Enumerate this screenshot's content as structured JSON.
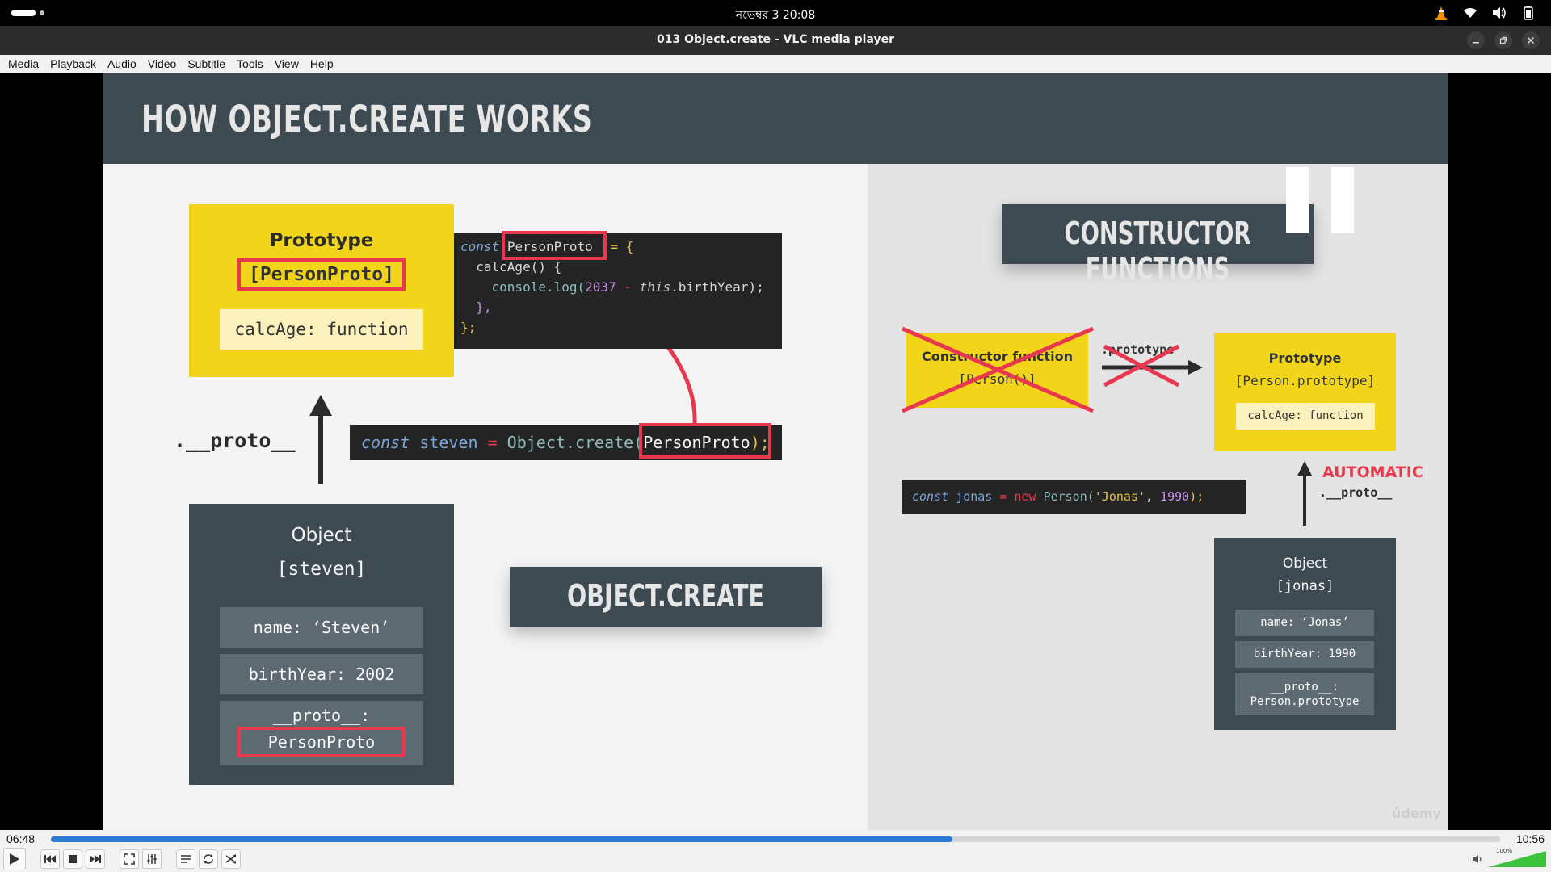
{
  "system_bar": {
    "clock": "নভেম্বর 3  20:08"
  },
  "window": {
    "title": "013 Object.create - VLC media player"
  },
  "menu": [
    "Media",
    "Playback",
    "Audio",
    "Video",
    "Subtitle",
    "Tools",
    "View",
    "Help"
  ],
  "slide": {
    "title": "HOW OBJECT.CREATE WORKS",
    "left": {
      "prototype_title": "Prototype",
      "prototype_name": "[PersonProto]",
      "prototype_method": "calcAge: function",
      "code": {
        "line1": [
          "const",
          "PersonProto",
          "= {"
        ],
        "line2": [
          "calcAge() {"
        ],
        "line3": [
          "console.log(",
          "2037",
          "-",
          "this",
          ".birthYear);"
        ],
        "line4": [
          "},"
        ],
        "line5": [
          "};"
        ]
      },
      "create_code": {
        "kw": "const",
        "var": "steven",
        "eq": "=",
        "call": "Object.create(",
        "arg": "PersonProto",
        "end": ");"
      },
      "proto_label": ".__proto__",
      "object_title": "Object",
      "object_name": "[steven]",
      "props": [
        "name: ‘Steven’",
        "birthYear: 2002"
      ],
      "proto_prop_label": "__proto__:",
      "proto_prop_value": "PersonProto",
      "banner": "OBJECT.CREATE"
    },
    "right": {
      "banner": "CONSTRUCTOR FUNCTIONS",
      "ctor_title": "Constructor function",
      "ctor_name": "[Person()]",
      "prototype_arrow_label": ".prototype",
      "prototype_title": "Prototype",
      "prototype_name": "[Person.prototype]",
      "prototype_method": "calcAge: function",
      "jonas_code": {
        "kw": "const",
        "var": "jonas",
        "eq": "=",
        "new": "new",
        "ctor": "Person(",
        "s1": "'Jonas'",
        "comma": ",",
        "num": "1990",
        "end": ");"
      },
      "automatic": "AUTOMATIC",
      "proto_label": ".__proto__",
      "object_title": "Object",
      "object_name": "[jonas]",
      "props": [
        "name: ‘Jonas’",
        "birthYear: 1990"
      ],
      "proto_prop_line1": "__proto__:",
      "proto_prop_line2": "Person.prototype"
    },
    "watermark": "ûdemy"
  },
  "player": {
    "elapsed": "06:48",
    "total": "10:56",
    "progress_fraction": 0.622,
    "volume_label": "100%",
    "volume_fraction": 1.0
  },
  "colors": {
    "accent_red": "#e8384f",
    "proto_yellow": "#f2d51b",
    "slate": "#3d4a52",
    "seek_blue": "#2b7bd6",
    "volume_green": "#3cc43c"
  }
}
